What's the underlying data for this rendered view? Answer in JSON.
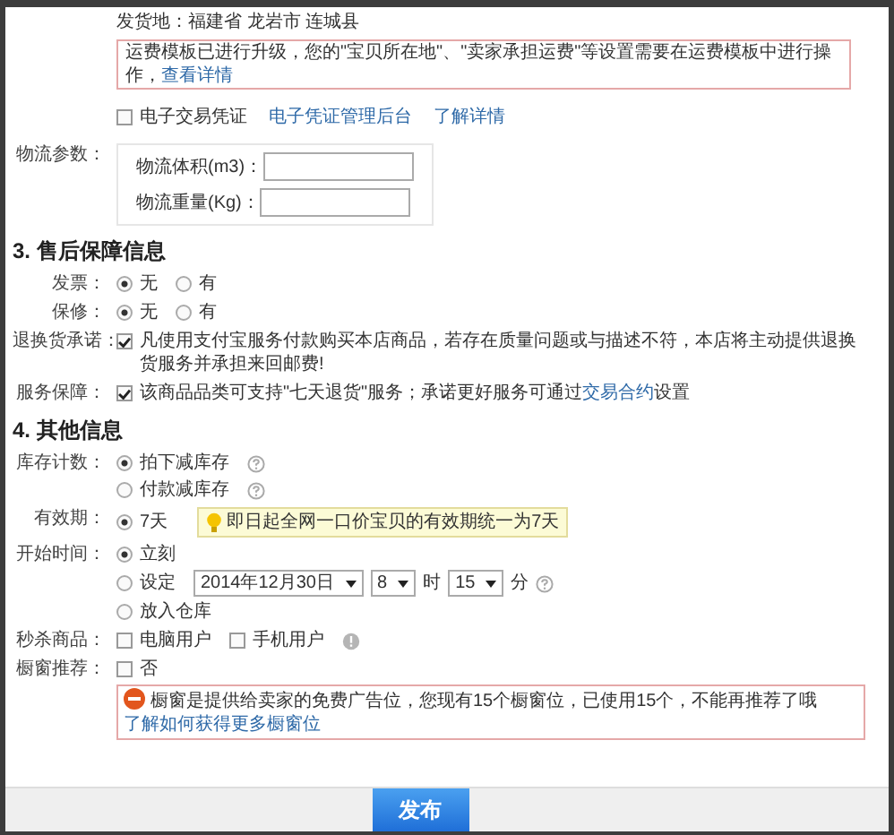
{
  "shipping": {
    "label": "发货地：",
    "value": "福建省 龙岩市 连城县"
  },
  "notice": {
    "text": "运费模板已进行升级，您的\"宝贝所在地\"、\"卖家承担运费\"等设置需要在运费模板中进行操作，",
    "link": "查看详情"
  },
  "e_voucher": {
    "text": "电子交易凭证",
    "checked": false,
    "links": [
      "电子凭证管理后台",
      "了解详情"
    ]
  },
  "logistics": {
    "label": "物流参数：",
    "fields": [
      {
        "label": "物流体积(m3)："
      },
      {
        "label": "物流重量(Kg)："
      }
    ]
  },
  "sections": [
    {
      "title": "3. 售后保障信息",
      "rows": [
        {
          "label": "发票：",
          "lines": [
            [
              {
                "kind": "radio",
                "text": "无",
                "selected": true
              },
              {
                "kind": "radio",
                "text": "有",
                "selected": false
              }
            ]
          ]
        },
        {
          "label": "保修：",
          "lines": [
            [
              {
                "kind": "radio",
                "text": "无",
                "selected": true
              },
              {
                "kind": "radio",
                "text": "有",
                "selected": false
              }
            ]
          ]
        },
        {
          "label": "退换货承诺：",
          "lines": [
            [
              {
                "kind": "checkbox",
                "checked": true,
                "text": "凡使用支付宝服务付款购买本店商品，若存在质量问题或与描述不符，本店将主动提供退换货服务并承担来回邮费!"
              }
            ]
          ]
        },
        {
          "label": "服务保障：",
          "lines": [
            [
              {
                "kind": "checkbox",
                "checked": true,
                "text": "该商品品类可支持\"七天退货\"服务；承诺更好服务可通过",
                "link": "交易合约",
                "after": "设置"
              }
            ]
          ]
        }
      ]
    },
    {
      "title": "4. 其他信息",
      "rows": [
        {
          "label": "库存计数：",
          "lines": [
            [
              {
                "kind": "radio",
                "text": "拍下减库存",
                "selected": true
              },
              {
                "kind": "help"
              }
            ],
            [
              {
                "kind": "radio",
                "text": "付款减库存",
                "selected": false
              },
              {
                "kind": "help"
              }
            ]
          ]
        },
        {
          "label": "有效期：",
          "lines": [
            [
              {
                "kind": "radio",
                "text": "7天",
                "selected": true
              },
              {
                "kind": "tip",
                "text": "即日起全网一口价宝贝的有效期统一为7天"
              }
            ]
          ]
        },
        {
          "label": "开始时间：",
          "lines": [
            [
              {
                "kind": "radio",
                "text": "立刻",
                "selected": true
              }
            ],
            [
              {
                "kind": "radio",
                "text": "设定",
                "selected": false
              },
              {
                "kind": "select",
                "value": "2014年12月30日"
              },
              {
                "kind": "select",
                "value": "8"
              },
              {
                "kind": "text",
                "text": "时"
              },
              {
                "kind": "select",
                "value": "15"
              },
              {
                "kind": "text",
                "text": "分"
              },
              {
                "kind": "help"
              }
            ],
            [
              {
                "kind": "radio",
                "text": "放入仓库",
                "selected": false
              }
            ]
          ]
        },
        {
          "label": "秒杀商品：",
          "lines": [
            [
              {
                "kind": "checkbox",
                "text": "电脑用户",
                "checked": false
              },
              {
                "kind": "checkbox",
                "text": "手机用户",
                "checked": false
              },
              {
                "kind": "info"
              }
            ]
          ]
        },
        {
          "label": "橱窗推荐：",
          "lines": [
            [
              {
                "kind": "checkbox",
                "text": "否",
                "checked": false
              }
            ],
            [
              {
                "kind": "warning",
                "text": "橱窗是提供给卖家的免费广告位，您现有15个橱窗位，已使用15个，不能再推荐了哦",
                "link": "了解如何获得更多橱窗位"
              }
            ]
          ]
        }
      ]
    }
  ],
  "publish": {
    "label": "发布"
  }
}
